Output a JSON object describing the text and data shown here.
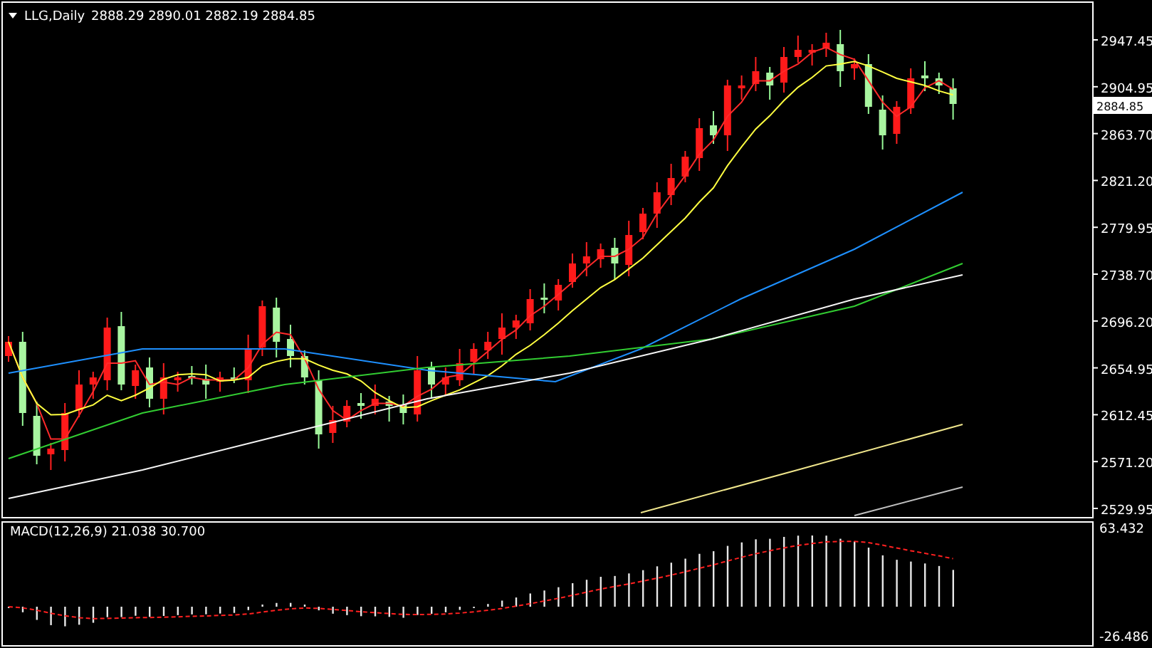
{
  "header": {
    "symbol": "LLG,Daily",
    "ohlc": "2888.29 2890.01 2882.19 2884.85"
  },
  "price_axis": {
    "labels": [
      "2947.45",
      "2904.95",
      "2863.70",
      "2821.20",
      "2779.95",
      "2738.70",
      "2696.20",
      "2654.95",
      "2612.45",
      "2571.20",
      "2529.95"
    ],
    "current_price": "2884.85"
  },
  "macd_panel": {
    "label": "MACD(12,26,9) 21.038 30.700",
    "axis_labels": [
      "63.432",
      "-26.486"
    ]
  }
}
